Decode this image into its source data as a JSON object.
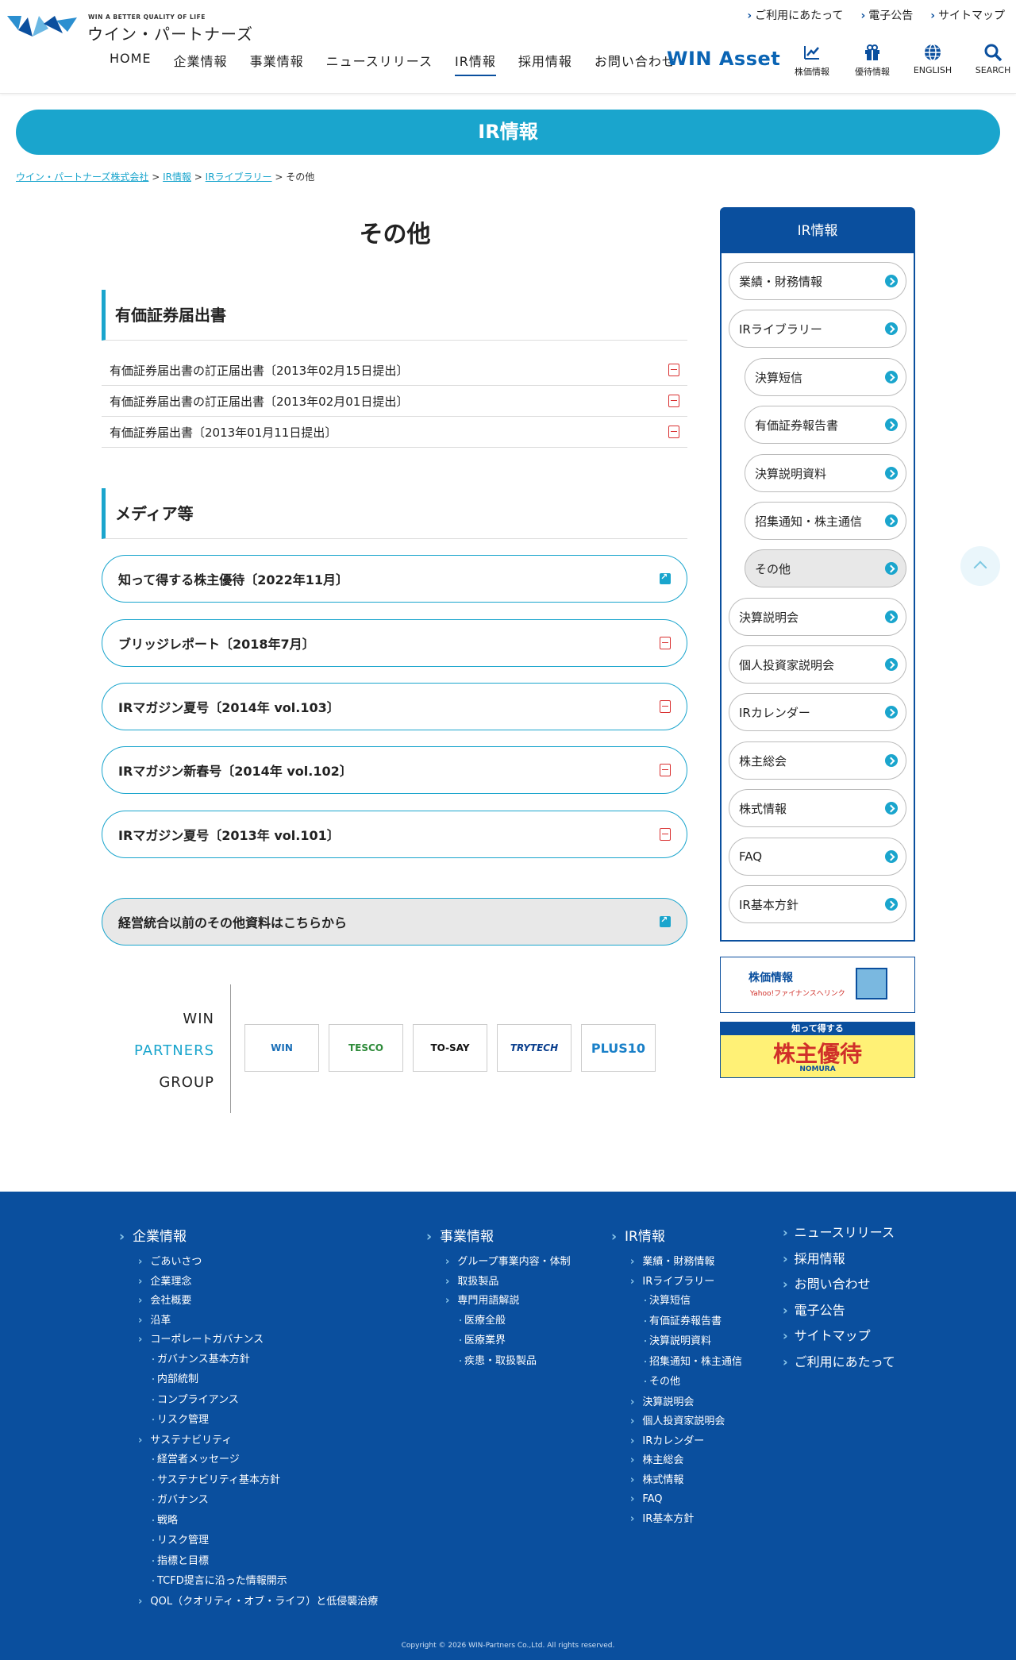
{
  "header": {
    "tagline": "WIN A BETTER QUALITY OF LIFE",
    "company": "ウイン・パートナーズ",
    "util": [
      "ご利用にあたって",
      "電子公告",
      "サイトマップ"
    ],
    "nav": [
      "HOME",
      "企業情報",
      "事業情報",
      "ニュースリリース",
      "IR情報",
      "採用情報",
      "お問い合わせ"
    ],
    "win_asset": "WIN Asset",
    "icons": [
      {
        "label": "株価情報",
        "icon": "chart-icon"
      },
      {
        "label": "優待情報",
        "icon": "gift-icon"
      },
      {
        "label": "ENGLISH",
        "icon": "globe-icon"
      },
      {
        "label": "SEARCH",
        "icon": "search-icon"
      }
    ]
  },
  "banner": {
    "title": "IR情報"
  },
  "breadcrumb": {
    "items": [
      "ウイン・パートナーズ株式会社",
      "IR情報",
      "IRライブラリー"
    ],
    "current": "その他"
  },
  "page": {
    "title": "その他"
  },
  "sections": {
    "s1": {
      "title": "有価証券届出書",
      "docs": [
        "有価証券届出書の訂正届出書〔2013年02月15日提出〕",
        "有価証券届出書の訂正届出書〔2013年02月01日提出〕",
        "有価証券届出書〔2013年01月11日提出〕"
      ]
    },
    "s2": {
      "title": "メディア等",
      "items": [
        "知って得する株主優待〔2022年11月〕",
        "ブリッジレポート〔2018年7月〕",
        "IRマガジン夏号〔2014年 vol.103〕",
        "IRマガジン新春号〔2014年 vol.102〕",
        "IRマガジン夏号〔2013年 vol.101〕"
      ]
    },
    "archive": "経営統合以前のその他資料はこちらから"
  },
  "group": {
    "lines": [
      "WIN",
      "PARTNERS",
      "GROUP"
    ],
    "logos": [
      "WIN",
      "TESCO",
      "TO-SAY",
      "TRYTECH",
      "PLUS10"
    ]
  },
  "sidebar": {
    "title": "IR情報",
    "items": [
      "業績・財務情報",
      "IRライブラリー",
      "決算短信",
      "有価証券報告書",
      "決算説明資料",
      "招集通知・株主通信",
      "その他",
      "決算説明会",
      "個人投資家説明会",
      "IRカレンダー",
      "株主総会",
      "株式情報",
      "FAQ",
      "IR基本方針"
    ]
  },
  "banners": {
    "stock": "株価情報",
    "stock_sub": "Yahoo!ファイナンスへリンク",
    "yutai_top": "知って得する",
    "yutai_main": "株主優待",
    "yutai_sub": "NOMURA"
  },
  "footer": {
    "col1": {
      "head": "企業情報",
      "items": [
        [
          "l1",
          "ごあいさつ"
        ],
        [
          "l1",
          "企業理念"
        ],
        [
          "l1",
          "会社概要"
        ],
        [
          "l1",
          "沿革"
        ],
        [
          "l1",
          "コーポレートガバナンス"
        ],
        [
          "l2",
          "ガバナンス基本方針"
        ],
        [
          "l2",
          "内部統制"
        ],
        [
          "l2",
          "コンプライアンス"
        ],
        [
          "l2",
          "リスク管理"
        ],
        [
          "l1",
          "サステナビリティ"
        ],
        [
          "l2",
          "経営者メッセージ"
        ],
        [
          "l2",
          "サステナビリティ基本方針"
        ],
        [
          "l2",
          "ガバナンス"
        ],
        [
          "l2",
          "戦略"
        ],
        [
          "l2",
          "リスク管理"
        ],
        [
          "l2",
          "指標と目標"
        ],
        [
          "l2",
          "TCFD提言に沿った情報開示"
        ],
        [
          "l1",
          "QOL（クオリティ・オブ・ライフ）と低侵襲治療"
        ]
      ]
    },
    "col2": {
      "head": "事業情報",
      "items": [
        [
          "l1",
          "グループ事業内容・体制"
        ],
        [
          "l1",
          "取扱製品"
        ],
        [
          "l1",
          "専門用語解説"
        ],
        [
          "l2",
          "医療全般"
        ],
        [
          "l2",
          "医療業界"
        ],
        [
          "l2",
          "疾患・取扱製品"
        ]
      ]
    },
    "col3": {
      "head": "IR情報",
      "items": [
        [
          "l1",
          "業績・財務情報"
        ],
        [
          "l1",
          "IRライブラリー"
        ],
        [
          "l2",
          "決算短信"
        ],
        [
          "l2",
          "有価証券報告書"
        ],
        [
          "l2",
          "決算説明資料"
        ],
        [
          "l2",
          "招集通知・株主通信"
        ],
        [
          "l2",
          "その他"
        ],
        [
          "l1",
          "決算説明会"
        ],
        [
          "l1",
          "個人投資家説明会"
        ],
        [
          "l1",
          "IRカレンダー"
        ],
        [
          "l1",
          "株主総会"
        ],
        [
          "l1",
          "株式情報"
        ],
        [
          "l1",
          "FAQ"
        ],
        [
          "l1",
          "IR基本方針"
        ]
      ]
    },
    "col4": [
      "ニュースリリース",
      "採用情報",
      "お問い合わせ",
      "電子公告",
      "サイトマップ",
      "ご利用にあたって"
    ],
    "copyright": "Copyright © 2026 WIN-Partners Co.,Ltd. All rights reserved."
  }
}
